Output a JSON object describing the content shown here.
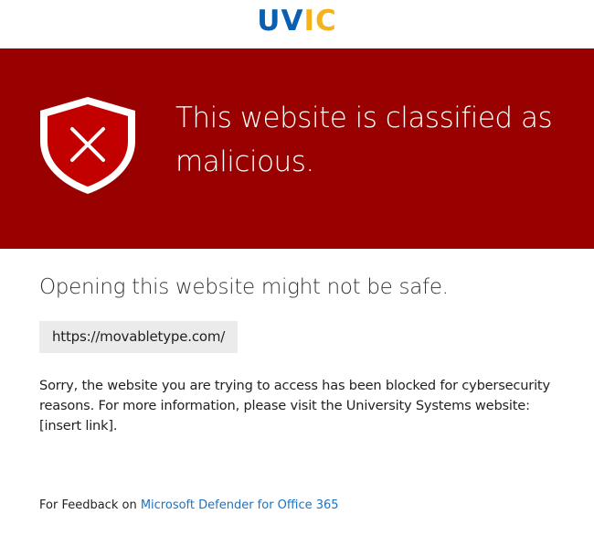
{
  "header": {
    "logo_text_part1": "UV",
    "logo_text_part2": "IC",
    "logo_name": "uvic-logo"
  },
  "banner": {
    "title": "This website is classified as malicious.",
    "background_color": "#990000",
    "icon": "shield-x-icon"
  },
  "main": {
    "subtitle": "Opening this website might not be safe.",
    "blocked_url": "https://movabletype.com/",
    "message": "Sorry, the website you are trying to access has been blocked for cybersecurity reasons. For more information, please visit the University Systems website: [insert link]."
  },
  "footer": {
    "feedback_prefix": "For Feedback on",
    "feedback_link": "Microsoft Defender for Office 365",
    "link_color": "#1b73c4"
  }
}
